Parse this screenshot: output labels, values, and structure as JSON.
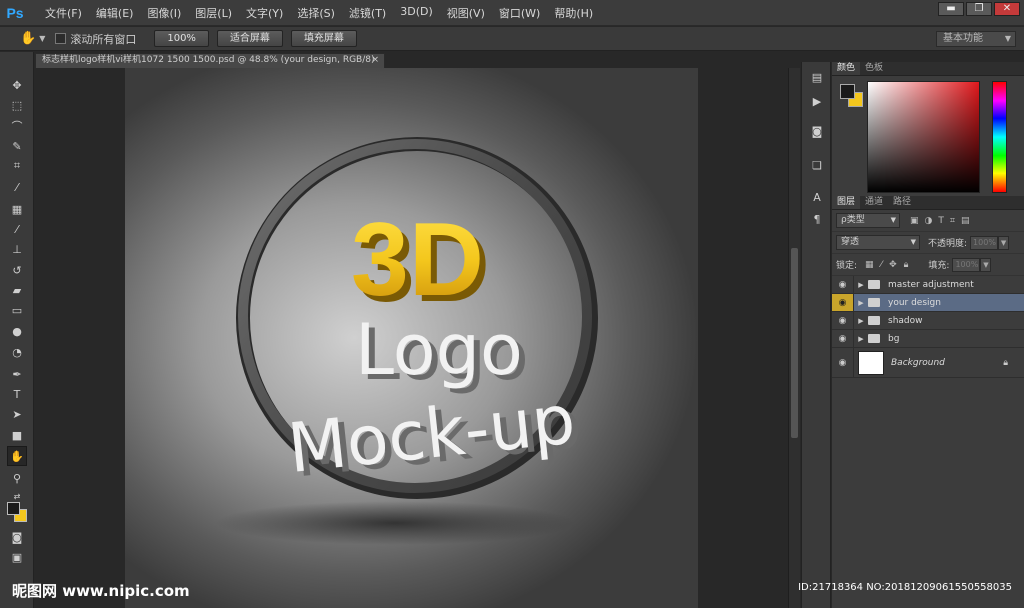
{
  "app": {
    "logo": "Ps",
    "menu": [
      "文件(F)",
      "编辑(E)",
      "图像(I)",
      "图层(L)",
      "文字(Y)",
      "选择(S)",
      "滤镜(T)",
      "3D(D)",
      "视图(V)",
      "窗口(W)",
      "帮助(H)"
    ],
    "window_buttons": {
      "minimize": "▬",
      "restore": "❐",
      "close": "✕"
    }
  },
  "options": {
    "tool_icon": "hand-icon",
    "scroll_all_label": "滚动所有窗口",
    "btn_100": "100%",
    "btn_fit": "适合屏幕",
    "btn_fill": "填充屏幕",
    "workspace": "基本功能"
  },
  "document": {
    "tab_title": "标志样机logo样机vi样机1072 1500 1500.psd @ 48.8% (your design, RGB/8)",
    "close": "×",
    "art": {
      "line1": "3D",
      "line2": "Logo",
      "line3": "Mock-up"
    }
  },
  "panels": {
    "color_tabs": [
      "颜色",
      "色板"
    ],
    "color": {
      "foreground": "#1a1a1a",
      "background": "#f4c71d",
      "field_hue": "#e0181c"
    },
    "layer_tabs": [
      "图层",
      "通道",
      "路径"
    ],
    "filter_label": "ρ类型",
    "blend_mode": "穿透",
    "opacity_label": "不透明度:",
    "opacity_value": "100%",
    "lock_label": "锁定:",
    "fill_label": "填充:",
    "fill_value": "100%",
    "layers": [
      {
        "name": "master adjustment",
        "type": "group",
        "selected": false
      },
      {
        "name": "your design",
        "type": "group",
        "selected": true
      },
      {
        "name": "shadow",
        "type": "group",
        "selected": false
      },
      {
        "name": "bg",
        "type": "group",
        "selected": false
      }
    ],
    "background_layer": "Background"
  },
  "watermark": {
    "left": "昵图网 www.nipic.com",
    "right": "ID:21718364 NO:20181209061550558035"
  },
  "colors": {
    "accent_blue": "#31a8ff",
    "selection": "#5b6b85",
    "gold": "#f4c71d"
  }
}
